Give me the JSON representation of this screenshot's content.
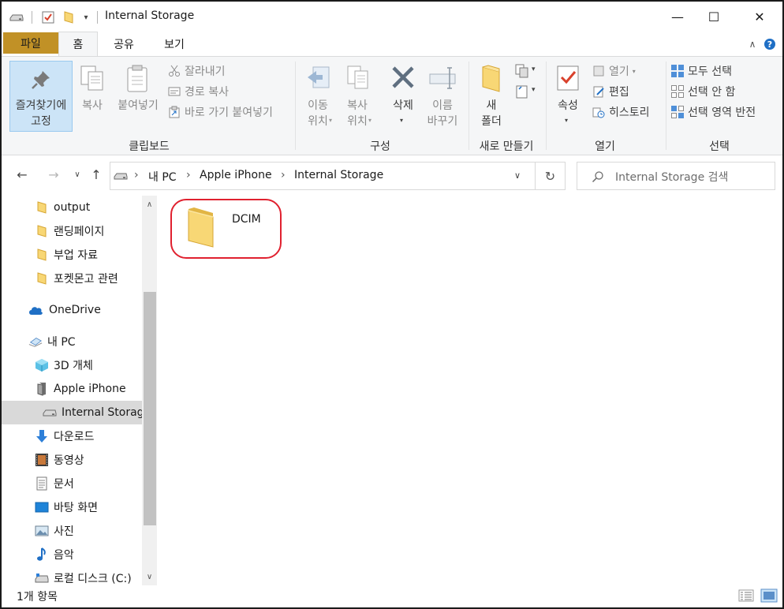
{
  "window": {
    "title": "Internal Storage",
    "controls": {
      "minimize": "—",
      "maximize": "☐",
      "close": "✕"
    }
  },
  "ribbon_tabs": [
    {
      "label": "파일"
    },
    {
      "label": "홈"
    },
    {
      "label": "공유"
    },
    {
      "label": "보기"
    }
  ],
  "ribbon": {
    "clipboard": {
      "group_label": "클립보드",
      "pin_line1": "즐겨찾기에",
      "pin_line2": "고정",
      "copy": "복사",
      "paste": "붙여넣기",
      "cut": "잘라내기",
      "copy_path": "경로 복사",
      "paste_shortcut": "바로 가기 붙여넣기"
    },
    "organize": {
      "group_label": "구성",
      "move_line1": "이동",
      "move_line2": "위치",
      "copyto_line1": "복사",
      "copyto_line2": "위치",
      "delete": "삭제",
      "rename_line1": "이름",
      "rename_line2": "바꾸기"
    },
    "new": {
      "group_label": "새로 만들기",
      "newfolder_line1": "새",
      "newfolder_line2": "폴더"
    },
    "open": {
      "group_label": "열기",
      "properties": "속성",
      "open": "열기",
      "edit": "편집",
      "history": "히스토리"
    },
    "select": {
      "group_label": "선택",
      "select_all": "모두 선택",
      "select_none": "선택 안 함",
      "invert": "선택 영역 반전"
    }
  },
  "address": {
    "crumbs": [
      "내 PC",
      "Apple iPhone",
      "Internal Storage"
    ],
    "search_placeholder": "Internal Storage 검색"
  },
  "nav_items": [
    {
      "label": "output"
    },
    {
      "label": "랜딩페이지"
    },
    {
      "label": "부업 자료"
    },
    {
      "label": "포켓몬고 관련"
    },
    {
      "label": "OneDrive"
    },
    {
      "label": "내 PC"
    },
    {
      "label": "3D 개체"
    },
    {
      "label": "Apple iPhone"
    },
    {
      "label": "Internal Storage"
    },
    {
      "label": "다운로드"
    },
    {
      "label": "동영상"
    },
    {
      "label": "문서"
    },
    {
      "label": "바탕 화면"
    },
    {
      "label": "사진"
    },
    {
      "label": "음악"
    },
    {
      "label": "로컬 디스크 (C:)"
    }
  ],
  "content": {
    "items": [
      {
        "name": "DCIM"
      }
    ]
  },
  "status": {
    "item_count": "1개 항목"
  },
  "colors": {
    "file_tab": "#c19126",
    "folder": "#f8d775",
    "highlight": "#e0212f",
    "selection": "#cce4f7",
    "accent_blue": "#1f6fc5"
  }
}
